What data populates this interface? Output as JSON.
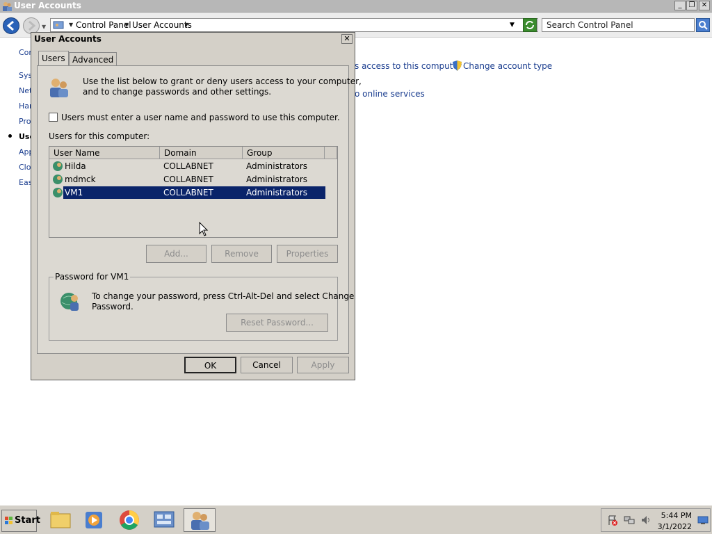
{
  "window": {
    "title": "User Accounts",
    "minimize_label": "_",
    "maximize_label": "❐",
    "close_label": "✕"
  },
  "addressbar": {
    "breadcrumbs": [
      "Control Panel",
      "User Accounts"
    ],
    "search_placeholder": "Search Control Panel"
  },
  "left_nav": {
    "items": [
      "Cor",
      "Sys",
      "Net",
      "Har",
      "Pro",
      "Use",
      "App",
      "Clo",
      "Eas"
    ]
  },
  "main_content": {
    "link_access": "s access to this computer",
    "link_change_type": "Change account type",
    "link_online": "o online services"
  },
  "dialog": {
    "title": "User Accounts",
    "close_label": "✕",
    "tabs": [
      "Users",
      "Advanced"
    ],
    "intro_text_1": "Use the list below to grant or deny users access to your computer,",
    "intro_text_2": "and to change passwords and other settings.",
    "checkbox_label": "Users must enter a user name and password to use this computer.",
    "users_label": "Users for this computer:",
    "columns": [
      "User Name",
      "Domain",
      "Group"
    ],
    "users": [
      {
        "name": "Hilda",
        "domain": "COLLABNET",
        "group": "Administrators"
      },
      {
        "name": "mdmck",
        "domain": "COLLABNET",
        "group": "Administrators"
      },
      {
        "name": "VM1",
        "domain": "COLLABNET",
        "group": "Administrators"
      }
    ],
    "selected_user": "VM1",
    "buttons": {
      "add": "Add...",
      "remove": "Remove",
      "properties": "Properties"
    },
    "password_group_label": "Password for VM1",
    "password_text_1": "To change your password, press Ctrl-Alt-Del and select Change",
    "password_text_2": "Password.",
    "reset_password": "Reset Password...",
    "ok": "OK",
    "cancel": "Cancel",
    "apply": "Apply"
  },
  "taskbar": {
    "start_label": "Start",
    "time": "5:44 PM",
    "date": "3/1/2022"
  }
}
